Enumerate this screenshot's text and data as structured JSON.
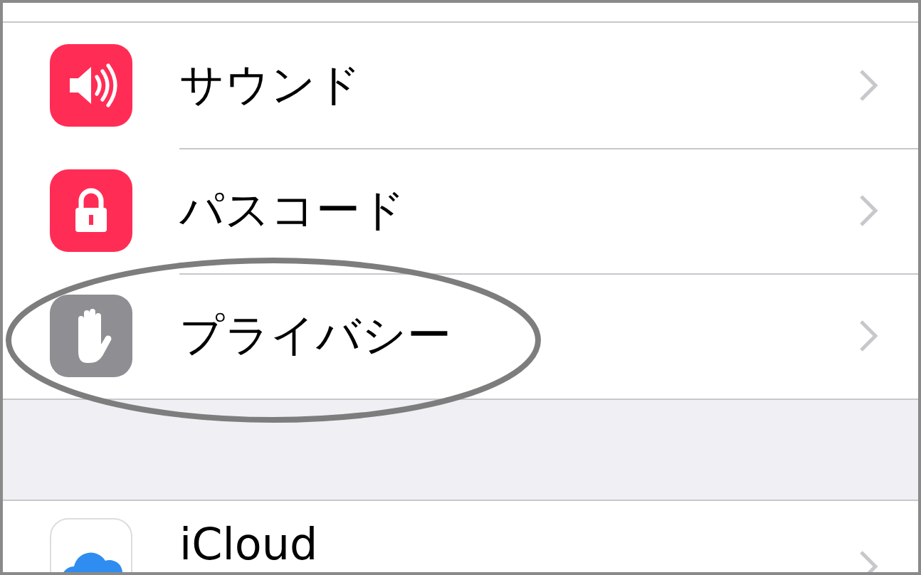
{
  "groups": [
    {
      "rows": [
        {
          "label": "サウンド"
        },
        {
          "label": "パスコード"
        },
        {
          "label": "プライバシー"
        }
      ]
    },
    {
      "rows": [
        {
          "label": "iCloud"
        }
      ]
    }
  ]
}
